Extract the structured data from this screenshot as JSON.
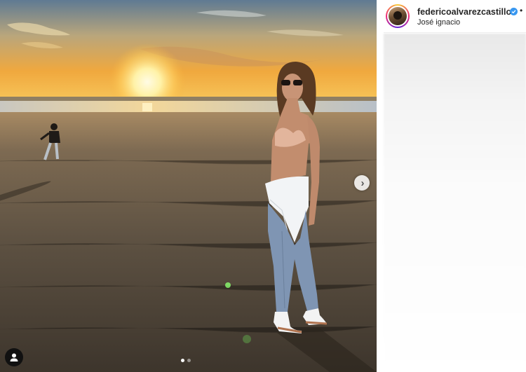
{
  "post": {
    "username": "federicoalvarezcastillo",
    "location": "José ignacio",
    "verified": true,
    "more_icon": "more-dots-icon"
  },
  "carousel": {
    "slide_count": 2,
    "active_slide": 1,
    "next_icon": "chevron-right-icon",
    "tag_icon": "user-tag-icon"
  },
  "colors": {
    "verified_blue": "#3897f0",
    "sky_top": "#5f7a93",
    "sunset_orange": "#f4a338",
    "sand": "#5a4d3e"
  }
}
